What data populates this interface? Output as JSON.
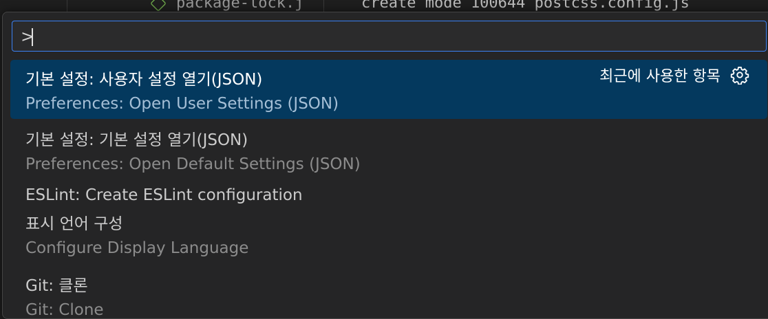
{
  "background": {
    "file_name": "package-lock.j",
    "terminal_line": "create mode 100644 postcss.config.js"
  },
  "command_palette": {
    "input_value": ">",
    "recent_label": "최근에 사용한 항목",
    "items": [
      {
        "label": "기본 설정: 사용자 설정 열기(JSON)",
        "detail": "Preferences: Open User Settings (JSON)"
      },
      {
        "label": "기본 설정: 기본 설정 열기(JSON)",
        "detail": "Preferences: Open Default Settings (JSON)"
      },
      {
        "label": "ESLint: Create ESLint configuration"
      },
      {
        "label": "표시 언어 구성",
        "detail": "Configure Display Language"
      },
      {
        "label": "Git: 클론",
        "detail": "Git: Clone"
      }
    ]
  },
  "icons": {
    "settings": "gear-icon",
    "file": "npm-file-icon"
  },
  "colors": {
    "accent": "#3b82f6",
    "selection": "#04395e",
    "background": "#252526"
  }
}
